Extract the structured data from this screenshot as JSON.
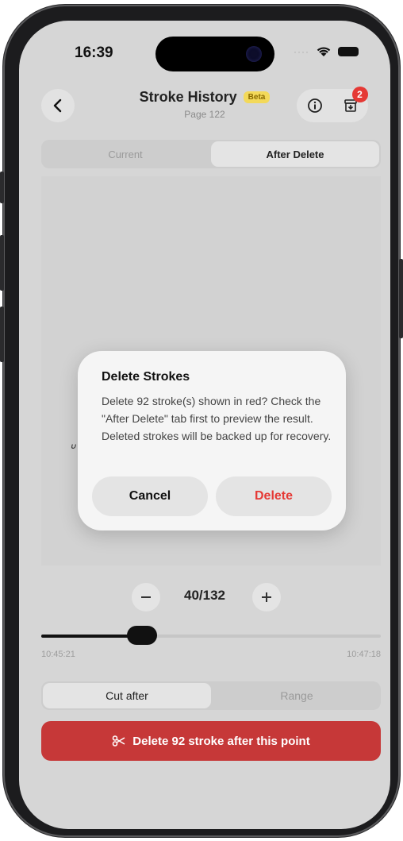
{
  "status_bar": {
    "time": "16:39"
  },
  "header": {
    "title": "Stroke History",
    "beta_label": "Beta",
    "subtitle": "Page 122",
    "badge_count": "2"
  },
  "tabs_top": {
    "current": "Current",
    "after_delete": "After Delete"
  },
  "dialog": {
    "title": "Delete Strokes",
    "message": "Delete 92 stroke(s) shown in red? Check the \"After Delete\" tab first to preview the result. Deleted strokes will be backed up for recovery.",
    "cancel": "Cancel",
    "delete": "Delete"
  },
  "pager": {
    "label": "40/132",
    "current": 40,
    "total": 132
  },
  "timeline": {
    "start": "10:45:21",
    "end": "10:47:18"
  },
  "tabs_bottom": {
    "cut_after": "Cut after",
    "range": "Range"
  },
  "action_button": {
    "label": "Delete 92 stroke after this point"
  },
  "colors": {
    "danger": "#c63838",
    "delete_text": "#e53935",
    "beta_bg": "#f3d95a"
  }
}
